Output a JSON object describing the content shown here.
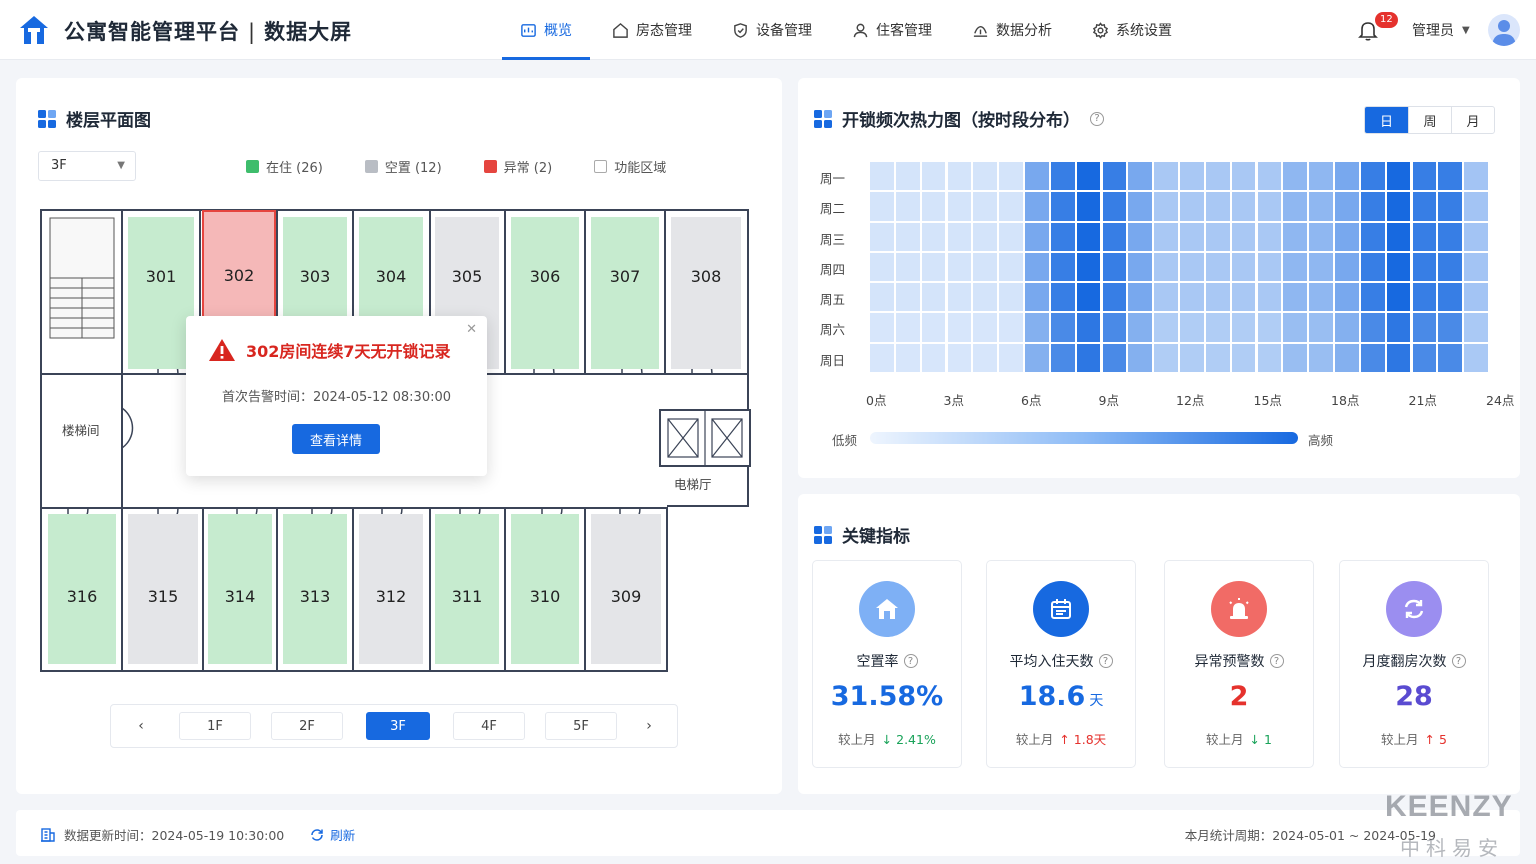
{
  "header": {
    "title": "公寓智能管理平台",
    "subtitle": "数据大屏",
    "nav": [
      {
        "label": "概览",
        "icon": "dashboard-icon"
      },
      {
        "label": "房态管理",
        "icon": "house-icon"
      },
      {
        "label": "设备管理",
        "icon": "shield-icon"
      },
      {
        "label": "住客管理",
        "icon": "user-icon"
      },
      {
        "label": "数据分析",
        "icon": "analytics-icon"
      },
      {
        "label": "系统设置",
        "icon": "gear-icon"
      }
    ],
    "notification_count": "12",
    "user_name": "管理员"
  },
  "floor_panel": {
    "title": "楼层平面图",
    "selected_floor": "3F",
    "legend": [
      {
        "label": "在住 (26)",
        "color": "#3ebd6c"
      },
      {
        "label": "空置 (12)",
        "color": "#b9bdc4"
      },
      {
        "label": "异常 (2)",
        "color": "#e5453f"
      },
      {
        "label": "功能区域",
        "color": "#ffffff"
      }
    ],
    "top_rooms": [
      {
        "no": "301",
        "status": "occupied"
      },
      {
        "no": "302",
        "status": "abnormal"
      },
      {
        "no": "303",
        "status": "occupied"
      },
      {
        "no": "304",
        "status": "occupied"
      },
      {
        "no": "305",
        "status": "vacant"
      },
      {
        "no": "306",
        "status": "occupied"
      },
      {
        "no": "307",
        "status": "occupied"
      },
      {
        "no": "308",
        "status": "vacant"
      }
    ],
    "bottom_rooms": [
      {
        "no": "316",
        "status": "occupied"
      },
      {
        "no": "315",
        "status": "vacant"
      },
      {
        "no": "314",
        "status": "occupied"
      },
      {
        "no": "313",
        "status": "occupied"
      },
      {
        "no": "312",
        "status": "vacant"
      },
      {
        "no": "311",
        "status": "occupied"
      },
      {
        "no": "310",
        "status": "occupied"
      },
      {
        "no": "309",
        "status": "vacant"
      }
    ],
    "stairs_label": "楼梯间",
    "elevator_label": "电梯厅",
    "alert": {
      "title": "302房间连续7天无开锁记录",
      "time": "首次告警时间：2024-05-12 08:30:00",
      "button": "查看详情"
    },
    "floors": [
      "1F",
      "2F",
      "3F",
      "4F",
      "5F"
    ],
    "active_floor": "3F"
  },
  "heatmap_panel": {
    "title": "开锁频次热力图（按时段分布）",
    "tabs": [
      "日",
      "周",
      "月"
    ],
    "active_tab": "日",
    "days": [
      "周一",
      "周二",
      "周三",
      "周四",
      "周五",
      "周六",
      "周日"
    ],
    "hour_labels": [
      "0点",
      "3点",
      "6点",
      "9点",
      "12点",
      "15点",
      "18点",
      "21点",
      "24点"
    ],
    "scale_low": "低频",
    "scale_high": "高频",
    "colors": {
      "low": "#eef5fe",
      "high": "#1769e0"
    }
  },
  "kpi_panel": {
    "title": "关键指标",
    "cards": [
      {
        "label": "空置率",
        "value": "31.58%",
        "unit": "",
        "compare": "较上月",
        "delta": "↓ 2.41%",
        "value_color": "#1769e0",
        "delta_color": "#1aa35a",
        "icon": "house-icon",
        "icon_bg": "#7eb0f5"
      },
      {
        "label": "平均入住天数",
        "value": "18.6",
        "unit": "天",
        "compare": "较上月",
        "delta": "↑ 1.8天",
        "value_color": "#1769e0",
        "delta_color": "#e5322d",
        "icon": "calendar-icon",
        "icon_bg": "#1769e0"
      },
      {
        "label": "异常预警数",
        "value": "2",
        "unit": "",
        "compare": "较上月",
        "delta": "↓ 1",
        "value_color": "#e5322d",
        "delta_color": "#1aa35a",
        "icon": "alarm-icon",
        "icon_bg": "#f16b66"
      },
      {
        "label": "月度翻房次数",
        "value": "28",
        "unit": "",
        "compare": "较上月",
        "delta": "↑ 5",
        "value_color": "#5a4bd1",
        "delta_color": "#e5322d",
        "icon": "refresh-icon",
        "icon_bg": "#9b8ef0"
      }
    ]
  },
  "footer": {
    "update_time": "数据更新时间：2024-05-19 10:30:00",
    "refresh": "刷新",
    "period": "本月统计周期：2024-05-01 ~ 2024-05-19"
  },
  "watermark": {
    "brand": "KEENZY",
    "cn": "中科易安"
  }
}
